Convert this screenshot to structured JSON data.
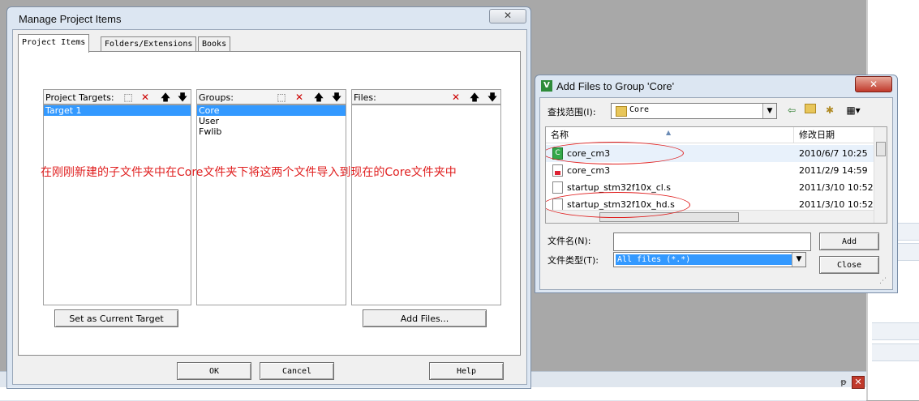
{
  "manage_dialog": {
    "title": "Manage Project Items",
    "close_glyph": "✕",
    "tabs": [
      "Project Items",
      "Folders/Extensions",
      "Books"
    ],
    "project_targets": {
      "label": "Project Targets:",
      "items": [
        "Target 1"
      ]
    },
    "groups": {
      "label": "Groups:",
      "items": [
        "Core",
        "User",
        "Fwlib"
      ]
    },
    "files": {
      "label": "Files:",
      "items": []
    },
    "set_target_button": "Set as Current Target",
    "add_files_button": "Add Files...",
    "ok_button": "OK",
    "cancel_button": "Cancel",
    "help_button": "Help",
    "icons": {
      "new": "⬚",
      "delete": "✕",
      "up": "🡅",
      "down": "🡇"
    }
  },
  "annotation": "在刚刚新建的子文件夹中在Core文件夹下将这两个文件导入到现在的Core文件夹中",
  "add_files_dialog": {
    "title": "Add Files to Group 'Core'",
    "app_icon": "V",
    "close_glyph": "✕",
    "look_in_label": "查找范围(I):",
    "look_in_value": "Core",
    "column_name": "名称",
    "column_date": "修改日期",
    "files": [
      {
        "name": "core_cm3",
        "date": "2010/6/7 10:25",
        "icon": "c-source-icon",
        "glyph": "C"
      },
      {
        "name": "core_cm3",
        "date": "2011/2/9 14:59",
        "icon": "header-file-icon",
        "glyph": ""
      },
      {
        "name": "startup_stm32f10x_cl.s",
        "date": "2011/3/10 10:52",
        "icon": "asm-file-icon",
        "glyph": ""
      },
      {
        "name": "startup_stm32f10x_hd.s",
        "date": "2011/3/10 10:52",
        "icon": "asm-file-icon",
        "glyph": ""
      }
    ],
    "file_name_label": "文件名(N):",
    "file_name_value": "",
    "file_type_label": "文件类型(T):",
    "file_type_value": "All files (*.*)",
    "add_button": "Add",
    "close_button": "Close"
  },
  "background": {
    "pin_glyph": "ᵽ",
    "close_glyph": "✕"
  }
}
